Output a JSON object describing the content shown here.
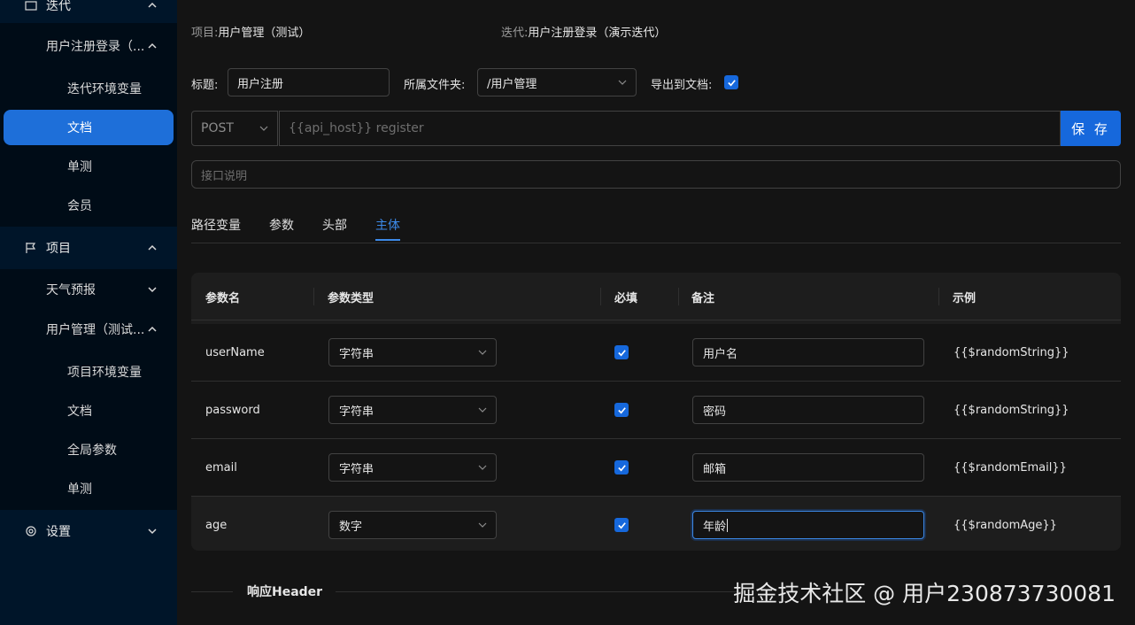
{
  "sidebar": {
    "iteration_group": "迭代",
    "iteration_item": "用户注册登录（...",
    "iteration_children": [
      "迭代环境变量",
      "文档",
      "单测",
      "会员"
    ],
    "project_group": "项目",
    "projects": [
      "天气预报",
      "用户管理（测试..."
    ],
    "project_children": [
      "项目环境变量",
      "文档",
      "全局参数",
      "单测"
    ],
    "settings_group": "设置"
  },
  "meta": {
    "project_label": "项目:",
    "project_value": "用户管理（测试）",
    "iteration_label": "迭代:",
    "iteration_value": "用户注册登录（演示迭代）"
  },
  "form": {
    "title_label": "标题:",
    "title_value": "用户注册",
    "folder_label": "所属文件夹:",
    "folder_value": "/用户管理",
    "export_label": "导出到文档:",
    "method": "POST",
    "url_placeholder": "{{api_host}} register",
    "save_label": "保 存",
    "desc_placeholder": "接口说明"
  },
  "tabs": [
    "路径变量",
    "参数",
    "头部",
    "主体"
  ],
  "table": {
    "columns": [
      "参数名",
      "参数类型",
      "必填",
      "备注",
      "示例"
    ],
    "rows": [
      {
        "name": "userName",
        "type": "字符串",
        "required": true,
        "remark": "用户名",
        "example": "{{$randomString}}"
      },
      {
        "name": "password",
        "type": "字符串",
        "required": true,
        "remark": "密码",
        "example": "{{$randomString}}"
      },
      {
        "name": "email",
        "type": "字符串",
        "required": true,
        "remark": "邮箱",
        "example": "{{$randomEmail}}"
      },
      {
        "name": "age",
        "type": "数字",
        "required": true,
        "remark": "年龄",
        "example": "{{$randomAge}}"
      }
    ]
  },
  "response_header_title": "响应Header",
  "watermark": "掘金技术社区 @ 用户230873730081",
  "colors": {
    "accent": "#1668dc",
    "sidebar": "#001529",
    "background": "#141414"
  }
}
